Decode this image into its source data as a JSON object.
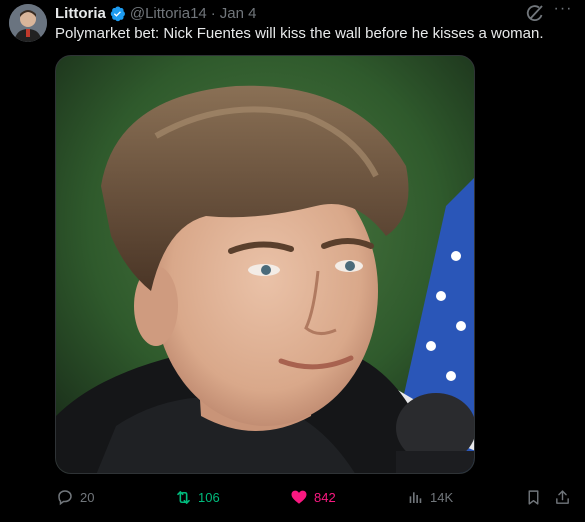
{
  "post": {
    "author_name": "Littoria",
    "handle": "@Littoria14",
    "separator": "·",
    "date": "Jan 4",
    "text": "Polymarket bet: Nick Fuentes will kiss the wall before he kisses a woman.",
    "verified": true,
    "verified_color": "#1d9bf0"
  },
  "media": {
    "description_icon": "photo"
  },
  "header_icons": {
    "grok": "grok-icon",
    "more": "more-icon",
    "more_label": "···"
  },
  "actions": {
    "reply_count": "20",
    "retweet_count": "106",
    "like_count": "842",
    "views_count": "14K"
  },
  "colors": {
    "background": "#000000",
    "text": "#e7e9ea",
    "muted": "#71767b",
    "retweet": "#00ba7c",
    "like": "#f91880",
    "verified": "#1d9bf0"
  }
}
